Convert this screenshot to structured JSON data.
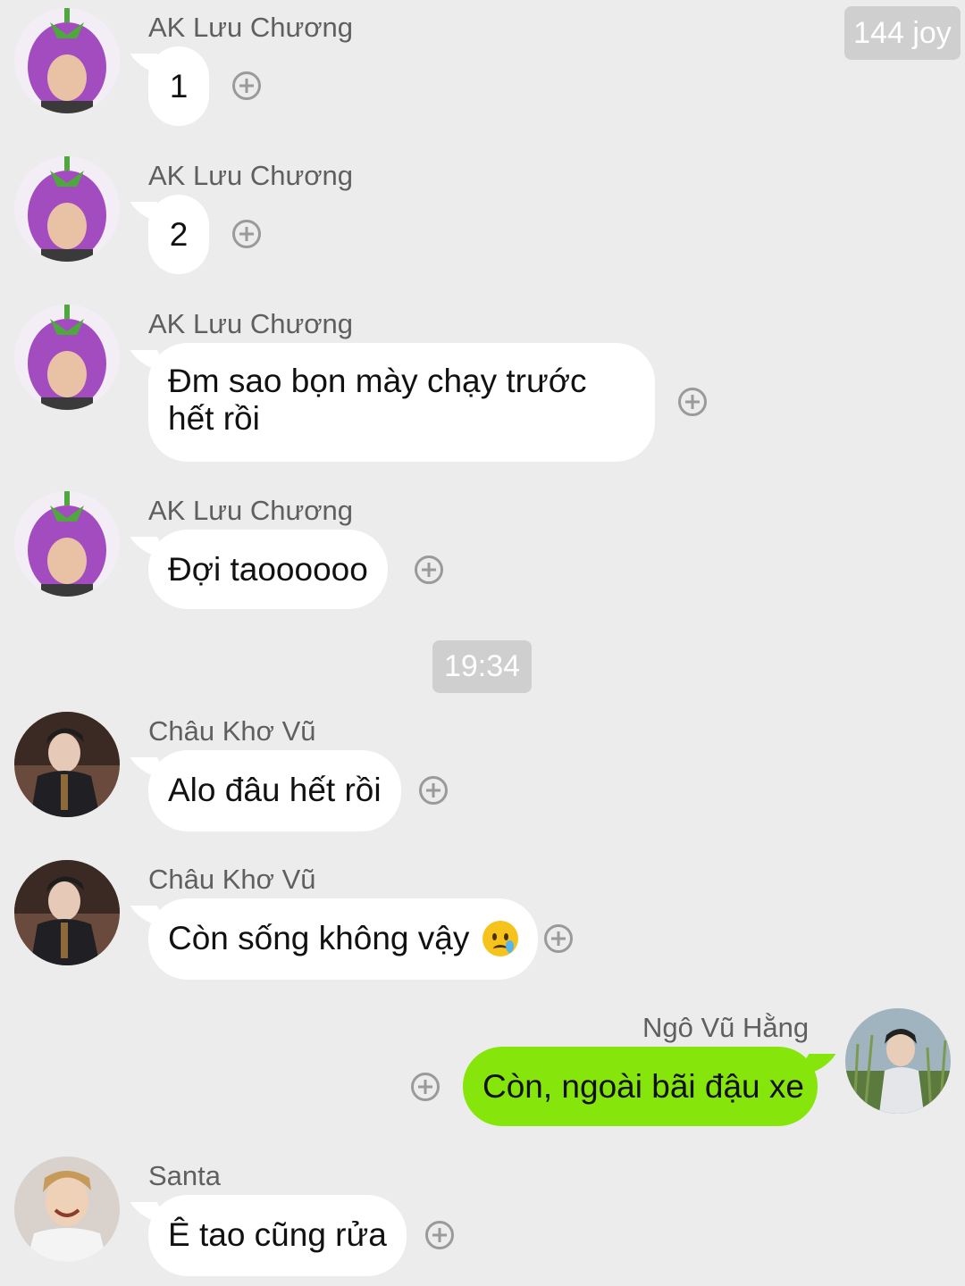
{
  "badge": {
    "label": "144 joy"
  },
  "time_separator": "19:34",
  "messages": [
    {
      "sender": "AK Lưu Chương",
      "text": "1",
      "avatar": "eggplant-hat-avatar"
    },
    {
      "sender": "AK Lưu Chương",
      "text": "2",
      "avatar": "eggplant-hat-avatar"
    },
    {
      "sender": "AK Lưu Chương",
      "text": "Đm sao bọn mày chạy trước hết rồi",
      "avatar": "eggplant-hat-avatar"
    },
    {
      "sender": "AK Lưu Chương",
      "text": "Đợi taoooooo",
      "avatar": "eggplant-hat-avatar"
    },
    {
      "sender": "Châu Khơ Vũ",
      "text": "Alo đâu hết rồi",
      "avatar": "dark-suit-avatar"
    },
    {
      "sender": "Châu Khơ Vũ",
      "text": "Còn sống không vậy",
      "emoji": "crying-face-icon",
      "avatar": "dark-suit-avatar"
    },
    {
      "sender": "Ngô Vũ Hằng",
      "text": "Còn, ngoài bãi đậu xe",
      "mine": true,
      "avatar": "outdoor-avatar"
    },
    {
      "sender": "Santa",
      "text": "Ê tao cũng rửa",
      "avatar": "smiling-avatar"
    }
  ],
  "colors": {
    "background": "#ececec",
    "bubble_incoming": "#ffffff",
    "bubble_outgoing": "#86e60b",
    "name_text": "#5f5f5f"
  }
}
